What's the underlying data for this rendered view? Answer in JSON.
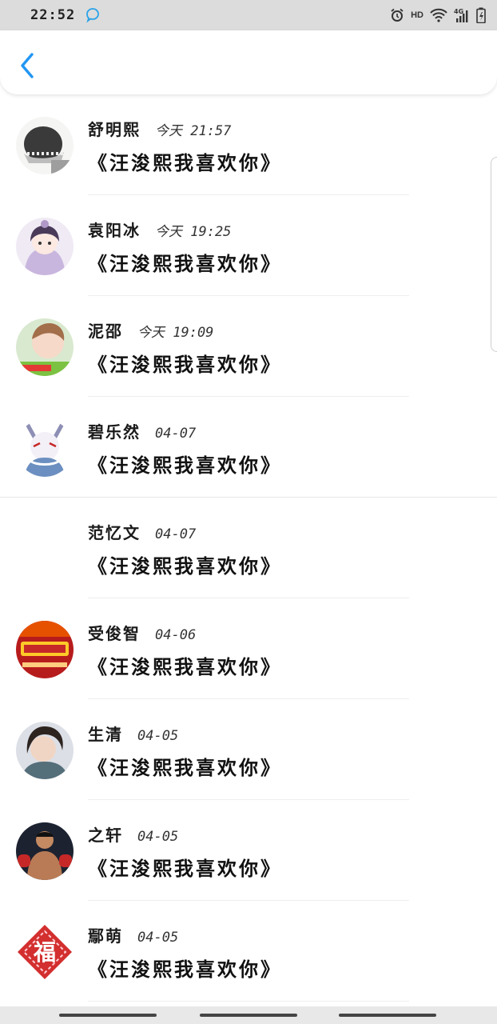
{
  "status_bar": {
    "time": "22:52",
    "hd": "HD",
    "icons": [
      "qq-bubble-icon",
      "alarm-icon",
      "wifi-icon",
      "signal-4g-icon",
      "battery-icon"
    ]
  },
  "nav": {
    "back_icon": "chevron-left-icon",
    "accent": "#2196f3"
  },
  "messages": [
    {
      "name": "舒明熙",
      "time": "今天 21:57",
      "text": "《汪浚熙我喜欢你》",
      "avatar": "black-hat"
    },
    {
      "name": "袁阳冰",
      "time": "今天 19:25",
      "text": "《汪浚熙我喜欢你》",
      "avatar": "anime-girl"
    },
    {
      "name": "泥邵",
      "time": "今天 19:09",
      "text": "《汪浚熙我喜欢你》",
      "avatar": "girl-photo"
    },
    {
      "name": "碧乐然",
      "time": "04-07",
      "text": "《汪浚熙我喜欢你》",
      "avatar": "fox-mask"
    },
    {
      "name": "范忆文",
      "time": "04-07",
      "text": "《汪浚熙我喜欢你》",
      "avatar": "none"
    },
    {
      "name": "受俊智",
      "time": "04-06",
      "text": "《汪浚熙我喜欢你》",
      "avatar": "red-banner"
    },
    {
      "name": "生清",
      "time": "04-05",
      "text": "《汪浚熙我喜欢你》",
      "avatar": "woman-photo"
    },
    {
      "name": "之轩",
      "time": "04-05",
      "text": "《汪浚熙我喜欢你》",
      "avatar": "boxer"
    },
    {
      "name": "鄢萌",
      "time": "04-05",
      "text": "《汪浚熙我喜欢你》",
      "avatar": "fu-seal",
      "avatar_text": "福"
    }
  ]
}
